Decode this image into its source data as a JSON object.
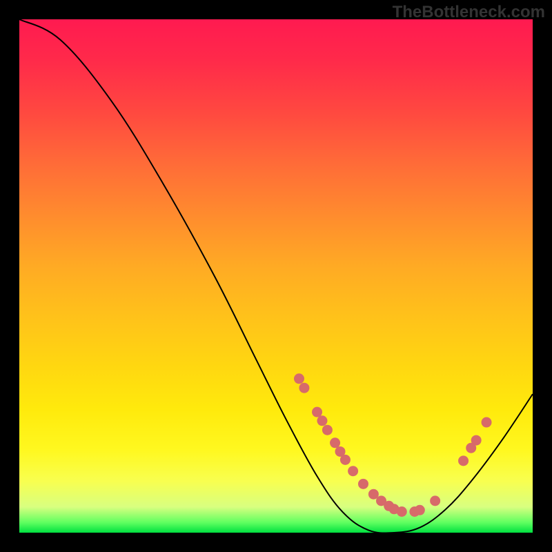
{
  "watermark": "TheBottleneck.com",
  "chart_data": {
    "type": "line",
    "title": "",
    "xlabel": "",
    "ylabel": "",
    "xlim": [
      0,
      100
    ],
    "ylim": [
      0,
      100
    ],
    "curve": [
      {
        "x": 0,
        "y": 100
      },
      {
        "x": 8,
        "y": 96
      },
      {
        "x": 18,
        "y": 84
      },
      {
        "x": 28,
        "y": 68
      },
      {
        "x": 38,
        "y": 50
      },
      {
        "x": 46,
        "y": 34
      },
      {
        "x": 52,
        "y": 22
      },
      {
        "x": 58,
        "y": 11
      },
      {
        "x": 63,
        "y": 4
      },
      {
        "x": 68,
        "y": 0.5
      },
      {
        "x": 73,
        "y": 0
      },
      {
        "x": 78,
        "y": 1
      },
      {
        "x": 83,
        "y": 4.5
      },
      {
        "x": 88,
        "y": 10
      },
      {
        "x": 94,
        "y": 18
      },
      {
        "x": 100,
        "y": 27
      }
    ],
    "dots": [
      {
        "x": 54.5,
        "y": 30
      },
      {
        "x": 55.5,
        "y": 28.2
      },
      {
        "x": 58,
        "y": 23.5
      },
      {
        "x": 59,
        "y": 21.8
      },
      {
        "x": 60,
        "y": 20
      },
      {
        "x": 61.5,
        "y": 17.5
      },
      {
        "x": 62.5,
        "y": 15.8
      },
      {
        "x": 63.5,
        "y": 14.2
      },
      {
        "x": 65,
        "y": 12
      },
      {
        "x": 67,
        "y": 9.5
      },
      {
        "x": 69,
        "y": 7.5
      },
      {
        "x": 70.5,
        "y": 6.2
      },
      {
        "x": 72,
        "y": 5.2
      },
      {
        "x": 73,
        "y": 4.6
      },
      {
        "x": 74.5,
        "y": 4.1
      },
      {
        "x": 77,
        "y": 4.1
      },
      {
        "x": 78,
        "y": 4.4
      },
      {
        "x": 81,
        "y": 6.2
      },
      {
        "x": 86.5,
        "y": 14
      },
      {
        "x": 88,
        "y": 16.5
      },
      {
        "x": 89,
        "y": 18
      },
      {
        "x": 91,
        "y": 21.5
      }
    ],
    "colors": {
      "curve": "#000000",
      "dots": "#d76a6a"
    }
  }
}
